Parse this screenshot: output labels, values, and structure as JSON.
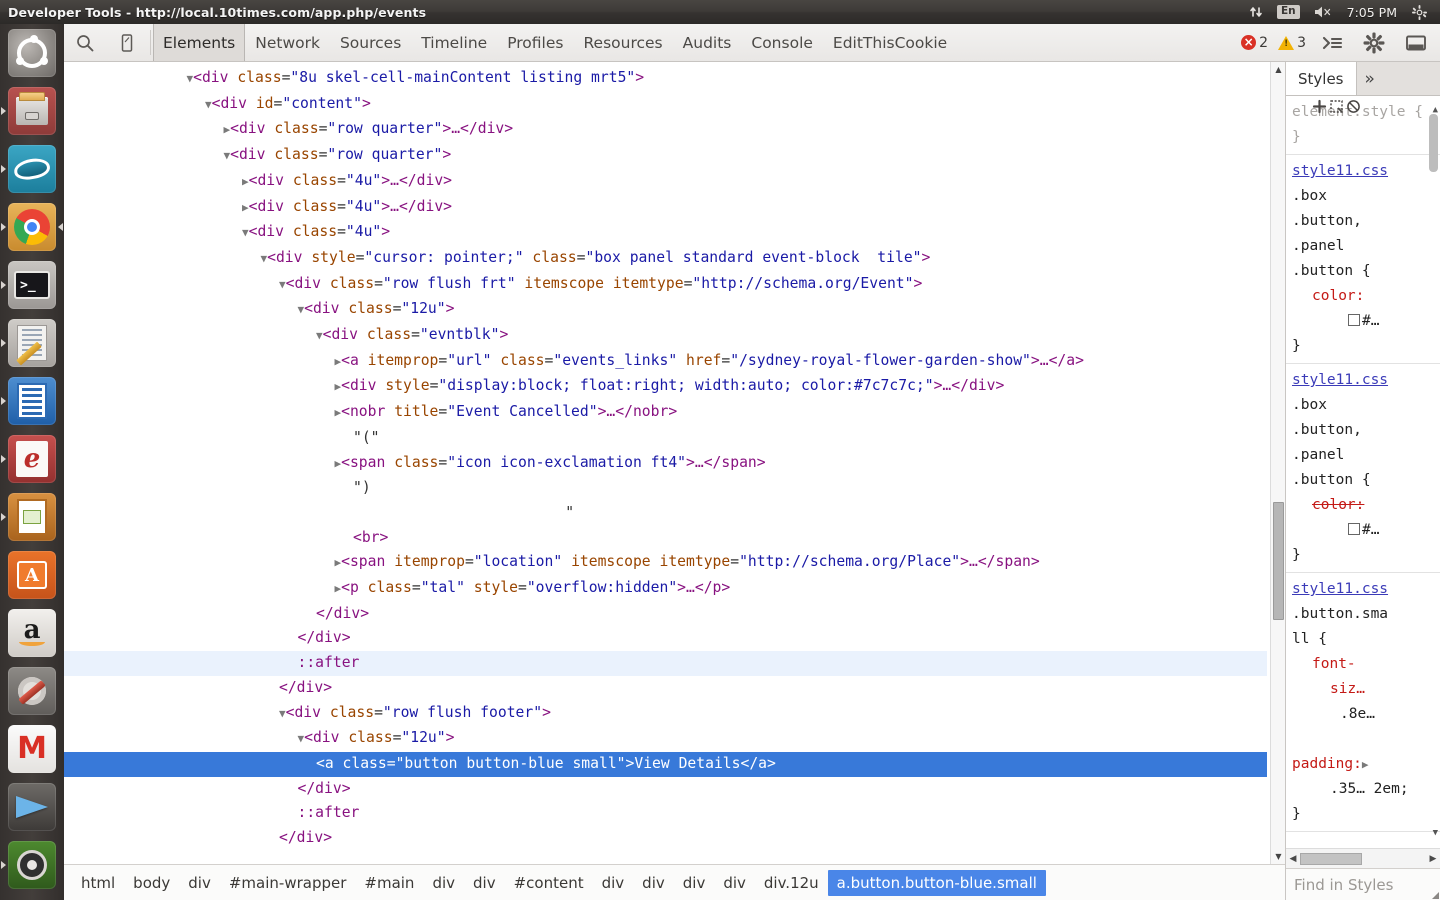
{
  "window": {
    "title": "Developer Tools - http://local.10times.com/app.php/events"
  },
  "system_panel": {
    "network_icon": "network-up-down-icon",
    "keyboard_layout": "En",
    "volume_icon": "volume-muted-icon",
    "clock": "7:05 PM",
    "gear_icon": "system-gear-icon"
  },
  "launcher": {
    "items": [
      {
        "name": "ubuntu-dash",
        "label": "Ubuntu Dash"
      },
      {
        "name": "files",
        "label": "Files"
      },
      {
        "name": "gwibber",
        "label": "Gwibber"
      },
      {
        "name": "google-chrome",
        "label": "Google Chrome"
      },
      {
        "name": "terminal",
        "label": "Terminal"
      },
      {
        "name": "text-editor",
        "label": "Text Editor"
      },
      {
        "name": "libreoffice-writer",
        "label": "LibreOffice Writer"
      },
      {
        "name": "document-viewer",
        "label": "Document Viewer"
      },
      {
        "name": "libreoffice-impress",
        "label": "LibreOffice Impress"
      },
      {
        "name": "ubuntu-software-center",
        "label": "Ubuntu Software Center"
      },
      {
        "name": "amazon",
        "label": "Amazon"
      },
      {
        "name": "system-settings",
        "label": "System Settings"
      },
      {
        "name": "gmail",
        "label": "Gmail"
      },
      {
        "name": "brasero",
        "label": "Brasero"
      },
      {
        "name": "workspace-switcher",
        "label": "Workspace Switcher"
      }
    ]
  },
  "devtools": {
    "toolbar": {
      "inspect_icon": "magnifier-inspect-icon",
      "device_icon": "device-toggle-icon",
      "tabs": [
        {
          "label": "Elements",
          "active": true
        },
        {
          "label": "Network",
          "active": false
        },
        {
          "label": "Sources",
          "active": false
        },
        {
          "label": "Timeline",
          "active": false
        },
        {
          "label": "Profiles",
          "active": false
        },
        {
          "label": "Resources",
          "active": false
        },
        {
          "label": "Audits",
          "active": false
        },
        {
          "label": "Console",
          "active": false
        },
        {
          "label": "EditThisCookie",
          "active": false
        }
      ],
      "error_count": "2",
      "warning_count": "3",
      "console_drawer_icon": "console-drawer-icon",
      "settings_icon": "gear-icon",
      "dock_icon": "dock-side-icon"
    },
    "dom_lines": [
      {
        "indent": 7,
        "html": "<span class=\"arrow\">▼</span><span class=\"tag\">&lt;div</span> <span class=\"attr\">class</span>=<span class=\"val\">\"8u skel-cell-mainContent listing mrt5\"</span><span class=\"tag\">&gt;</span>"
      },
      {
        "indent": 8,
        "html": "<span class=\"arrow\">▼</span><span class=\"tag\">&lt;div</span> <span class=\"attr\">id</span>=<span class=\"val\">\"content\"</span><span class=\"tag\">&gt;</span>"
      },
      {
        "indent": 9,
        "html": "<span class=\"arrow\">▶</span><span class=\"tag\">&lt;div</span> <span class=\"attr\">class</span>=<span class=\"val\">\"row quarter\"</span><span class=\"tag\">&gt;…&lt;/div&gt;</span>"
      },
      {
        "indent": 9,
        "html": "<span class=\"arrow\">▼</span><span class=\"tag\">&lt;div</span> <span class=\"attr\">class</span>=<span class=\"val\">\"row quarter\"</span><span class=\"tag\">&gt;</span>"
      },
      {
        "indent": 10,
        "html": "<span class=\"arrow\">▶</span><span class=\"tag\">&lt;div</span> <span class=\"attr\">class</span>=<span class=\"val\">\"4u\"</span><span class=\"tag\">&gt;…&lt;/div&gt;</span>"
      },
      {
        "indent": 10,
        "html": "<span class=\"arrow\">▶</span><span class=\"tag\">&lt;div</span> <span class=\"attr\">class</span>=<span class=\"val\">\"4u\"</span><span class=\"tag\">&gt;…&lt;/div&gt;</span>"
      },
      {
        "indent": 10,
        "html": "<span class=\"arrow\">▼</span><span class=\"tag\">&lt;div</span> <span class=\"attr\">class</span>=<span class=\"val\">\"4u\"</span><span class=\"tag\">&gt;</span>"
      },
      {
        "indent": 11,
        "html": "<span class=\"arrow\">▼</span><span class=\"tag\">&lt;div</span> <span class=\"attr\">style</span>=<span class=\"val\">\"cursor: pointer;\"</span> <span class=\"attr\">class</span>=<span class=\"val\">\"box panel standard event-block  tile\"</span><span class=\"tag\">&gt;</span>"
      },
      {
        "indent": 12,
        "html": "<span class=\"arrow\">▼</span><span class=\"tag\">&lt;div</span> <span class=\"attr\">class</span>=<span class=\"val\">\"row flush frt\"</span> <span class=\"attr\">itemscope itemtype</span>=<span class=\"val\">\"http://schema.org/Event\"</span><span class=\"tag\">&gt;</span>"
      },
      {
        "indent": 13,
        "html": "<span class=\"arrow\">▼</span><span class=\"tag\">&lt;div</span> <span class=\"attr\">class</span>=<span class=\"val\">\"12u\"</span><span class=\"tag\">&gt;</span>"
      },
      {
        "indent": 14,
        "html": "<span class=\"arrow\">▼</span><span class=\"tag\">&lt;div</span> <span class=\"attr\">class</span>=<span class=\"val\">\"evntblk\"</span><span class=\"tag\">&gt;</span>"
      },
      {
        "indent": 15,
        "html": "<span class=\"arrow\">▶</span><span class=\"tag\">&lt;a</span> <span class=\"attr\">itemprop</span>=<span class=\"val\">\"url\"</span> <span class=\"attr\">class</span>=<span class=\"val\">\"events_links\"</span> <span class=\"attr\">href</span>=<span class=\"val\">\"/sydney-royal-flower-garden-show\"</span><span class=\"tag\">&gt;…&lt;/a&gt;</span>"
      },
      {
        "indent": 15,
        "html": "<span class=\"arrow\">▶</span><span class=\"tag\">&lt;div</span> <span class=\"attr\">style</span>=<span class=\"val\">\"display:block; float:right; width:auto; color:#7c7c7c;\"</span><span class=\"tag\">&gt;…&lt;/div&gt;</span>"
      },
      {
        "indent": 15,
        "html": "<span class=\"arrow\">▶</span><span class=\"tag\">&lt;nobr</span> <span class=\"attr\">title</span>=<span class=\"val\">\"Event Cancelled\"</span><span class=\"tag\">&gt;…&lt;/nobr&gt;</span>"
      },
      {
        "indent": 16,
        "html": "<span class=\"txt\">\"(\"</span>"
      },
      {
        "indent": 15,
        "html": "<span class=\"arrow\">▶</span><span class=\"tag\">&lt;span</span> <span class=\"attr\">class</span>=<span class=\"val\">\"icon icon-exclamation ft4\"</span><span class=\"tag\">&gt;…&lt;/span&gt;</span>"
      },
      {
        "indent": 16,
        "html": "<span class=\"txt\">\")</span>"
      },
      {
        "indent": 16,
        "html": "<span class=\"txt\">                        \"</span>"
      },
      {
        "indent": 16,
        "html": "<span class=\"tag\">&lt;br&gt;</span>"
      },
      {
        "indent": 15,
        "html": "<span class=\"arrow\">▶</span><span class=\"tag\">&lt;span</span> <span class=\"attr\">itemprop</span>=<span class=\"val\">\"location\"</span> <span class=\"attr\">itemscope itemtype</span>=<span class=\"val\">\"http://schema.org/Place\"</span><span class=\"tag\">&gt;…&lt;/span&gt;</span>"
      },
      {
        "indent": 15,
        "html": "<span class=\"arrow\">▶</span><span class=\"tag\">&lt;p</span> <span class=\"attr\">class</span>=<span class=\"val\">\"tal\"</span> <span class=\"attr\">style</span>=<span class=\"val\">\"overflow:hidden\"</span><span class=\"tag\">&gt;…&lt;/p&gt;</span>"
      },
      {
        "indent": 14,
        "html": "<span class=\"tag\">&lt;/div&gt;</span>"
      },
      {
        "indent": 13,
        "html": "<span class=\"tag\">&lt;/div&gt;</span>"
      },
      {
        "indent": 13,
        "html": "<span class=\"pseudo\">::after</span>",
        "highlight": true
      },
      {
        "indent": 12,
        "html": "<span class=\"tag\">&lt;/div&gt;</span>"
      },
      {
        "indent": 12,
        "html": "<span class=\"arrow\">▼</span><span class=\"tag\">&lt;div</span> <span class=\"attr\">class</span>=<span class=\"val\">\"row flush footer\"</span><span class=\"tag\">&gt;</span>"
      },
      {
        "indent": 13,
        "html": "<span class=\"arrow\">▼</span><span class=\"tag\">&lt;div</span> <span class=\"attr\">class</span>=<span class=\"val\">\"12u\"</span><span class=\"tag\">&gt;</span>"
      },
      {
        "indent": 14,
        "html": "<span class=\"tag\">&lt;a</span> <span class=\"attr\">class</span>=<span class=\"val\">\"button button-blue small\"</span><span class=\"tag\">&gt;</span><span class=\"txt\">View Details</span><span class=\"tag\">&lt;/a&gt;</span>",
        "selected": true
      },
      {
        "indent": 13,
        "html": "<span class=\"tag\">&lt;/div&gt;</span>"
      },
      {
        "indent": 13,
        "html": "<span class=\"pseudo\">::after</span>"
      },
      {
        "indent": 12,
        "html": "<span class=\"tag\">&lt;/div&gt;</span>"
      }
    ],
    "breadcrumbs": [
      {
        "label": "html",
        "active": false
      },
      {
        "label": "body",
        "active": false
      },
      {
        "label": "div",
        "active": false
      },
      {
        "label": "#main-wrapper",
        "active": false
      },
      {
        "label": "#main",
        "active": false
      },
      {
        "label": "div",
        "active": false
      },
      {
        "label": "div",
        "active": false
      },
      {
        "label": "#content",
        "active": false
      },
      {
        "label": "div",
        "active": false
      },
      {
        "label": "div",
        "active": false
      },
      {
        "label": "div",
        "active": false
      },
      {
        "label": "div",
        "active": false
      },
      {
        "label": "div.12u",
        "active": false
      },
      {
        "label": "a.button.button-blue.small",
        "active": true
      }
    ],
    "styles": {
      "tab_label": "Styles",
      "more_label": "»",
      "element_style": {
        "selector": "element.style {",
        "close": "}",
        "icons": [
          "new-rule-plus-icon",
          "element-state-icon",
          "no-styles-icon"
        ]
      },
      "rules": [
        {
          "source": "style11.css",
          "selector_lines": [
            ".box",
            ".button,",
            ".panel",
            ".button {"
          ],
          "property": "color:",
          "overridden": false,
          "value": "#…",
          "swatch_color": "#ffffff",
          "close": "}"
        },
        {
          "source": "style11.css",
          "selector_lines": [
            ".box",
            ".button,",
            ".panel",
            ".button {"
          ],
          "property": "color:",
          "overridden": true,
          "value": "#…",
          "swatch_color": "#ffffff",
          "close": "}"
        },
        {
          "source": "style11.css",
          "selector_lines": [
            ".button.sma",
            "ll {"
          ],
          "properties": [
            {
              "name": "font-",
              "cont": "siz…",
              "value": ".8e…"
            },
            {
              "name": "padding:",
              "cont": "",
              "value": ".35… 2em;",
              "expandable": true
            }
          ],
          "close": "}"
        }
      ],
      "find_placeholder": "Find in Styles"
    }
  }
}
